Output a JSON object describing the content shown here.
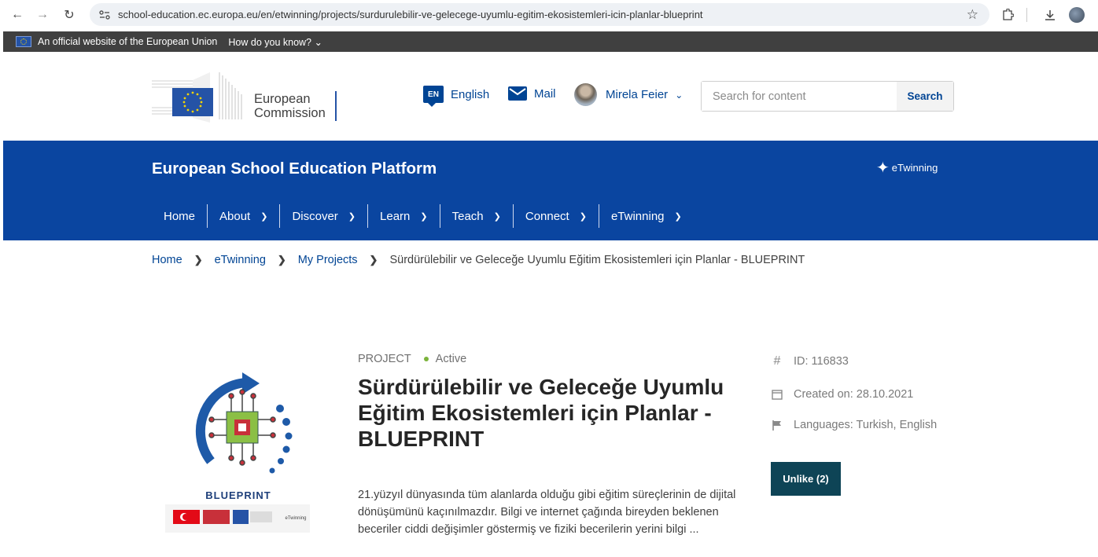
{
  "browser": {
    "url": "school-education.ec.europa.eu/en/etwinning/projects/surdurulebilir-ve-gelecege-uyumlu-egitim-ekosistemleri-icin-planlar-blueprint",
    "icons": [
      "back-icon",
      "forward-icon",
      "reload-icon",
      "site-info-icon",
      "bookmark-star-icon",
      "extensions-icon",
      "download-icon",
      "profile-icon",
      "menu-icon"
    ]
  },
  "eu_banner": {
    "official_text": "An official website of the European Union",
    "how_know": "How do you know?"
  },
  "header": {
    "logo_line1": "European",
    "logo_line2": "Commission",
    "language_code": "EN",
    "language_label": "English",
    "mail_label": "Mail",
    "user_name": "Mirela Feier",
    "search_placeholder": "Search for content",
    "search_button": "Search"
  },
  "platform": {
    "title": "European School Education Platform",
    "etwinning_logo": "eTwinning",
    "nav": [
      {
        "label": "Home",
        "dropdown": false
      },
      {
        "label": "About",
        "dropdown": true
      },
      {
        "label": "Discover",
        "dropdown": true
      },
      {
        "label": "Learn",
        "dropdown": true
      },
      {
        "label": "Teach",
        "dropdown": true
      },
      {
        "label": "Connect",
        "dropdown": true
      },
      {
        "label": "eTwinning",
        "dropdown": true
      }
    ]
  },
  "breadcrumb": {
    "items": [
      "Home",
      "eTwinning",
      "My Projects"
    ],
    "current": "Sürdürülebilir ve Geleceğe Uyumlu Eğitim Ekosistemleri için Planlar - BLUEPRINT"
  },
  "project": {
    "type": "PROJECT",
    "status": "Active",
    "title": "Sürdürülebilir ve Geleceğe Uyumlu Eğitim Ekosistemleri için Planlar - BLUEPRINT",
    "description": "21.yüzyıl dünyasında tüm alanlarda olduğu gibi eğitim süreçlerinin de dijital dönüşümünü kaçınılmazdır. Bilgi ve internet çağında bireyden beklenen beceriler ciddi değişimler göstermiş ve fiziki becerilerin yerini bilgi ...",
    "logo_text": "BLUEPRINT",
    "id_text": "ID: 116833",
    "created_text": "Created on: 28.10.2021",
    "languages_text": "Languages: Turkish, English",
    "unlike_button": "Unlike (2)"
  },
  "colors": {
    "brand_blue": "#004494",
    "platform_band": "#0a45a0",
    "status_green": "#7bb33b",
    "unlike_bg": "#0e4456"
  }
}
